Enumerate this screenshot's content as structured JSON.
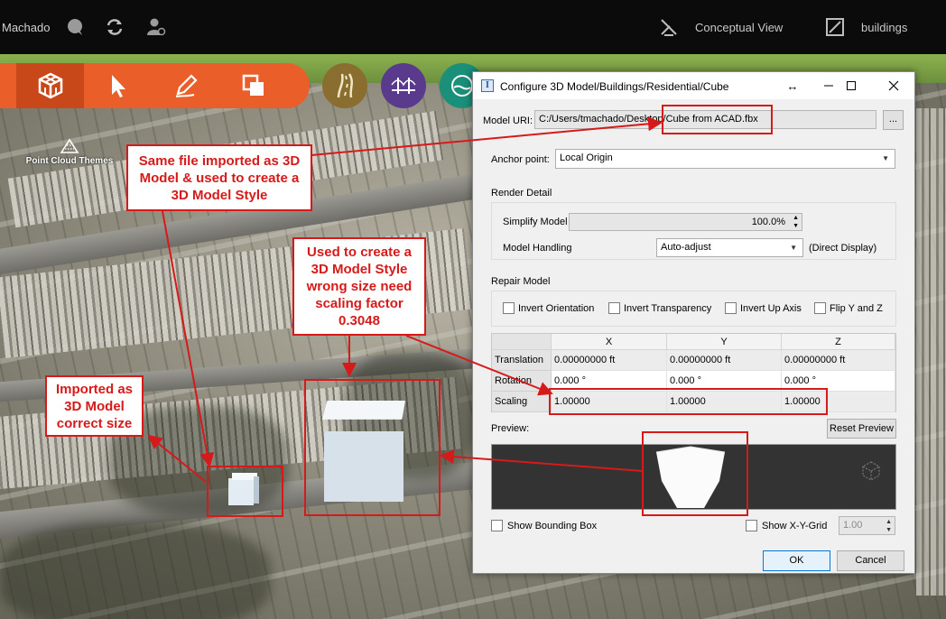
{
  "topbar": {
    "user": "Machado",
    "view_mode": "Conceptual View",
    "layer": "buildings"
  },
  "scene": {
    "point_cloud_label": "Point Cloud Themes"
  },
  "annotations": {
    "callout_same_file": "Same file  imported as 3D Model & used to create a 3D Model Style",
    "callout_style": "Used to create a 3D Model  Style wrong size need scaling factor 0.3048",
    "callout_model": "Imported as 3D Model correct size"
  },
  "dialog": {
    "title": "Configure 3D Model/Buildings/Residential/Cube",
    "model_uri_label": "Model URI:",
    "model_uri_value": "C:/Users/tmachado/Desktop/Cube from ACAD.fbx",
    "browse_label": "...",
    "anchor_label": "Anchor point:",
    "anchor_value": "Local Origin",
    "render_detail_label": "Render Detail",
    "simplify_label": "Simplify Model",
    "simplify_value": "100.0%",
    "handling_label": "Model Handling",
    "handling_value": "Auto-adjust",
    "handling_note": "(Direct Display)",
    "repair_label": "Repair Model",
    "repair_options": [
      "Invert Orientation",
      "Invert Transparency",
      "Invert Up Axis",
      "Flip Y and Z"
    ],
    "grid": {
      "columns": [
        "X",
        "Y",
        "Z"
      ],
      "rows": [
        {
          "label": "Translation",
          "values": [
            "0.00000000 ft",
            "0.00000000 ft",
            "0.00000000 ft"
          ]
        },
        {
          "label": "Rotation",
          "values": [
            "0.000 °",
            "0.000 °",
            "0.000 °"
          ]
        },
        {
          "label": "Scaling",
          "values": [
            "1.00000",
            "1.00000",
            "1.00000"
          ]
        }
      ]
    },
    "preview_label": "Preview:",
    "reset_preview_label": "Reset Preview",
    "show_bbox_label": "Show Bounding Box",
    "show_grid_label": "Show X-Y-Grid",
    "grid_spacing_value": "1.00",
    "ok_label": "OK",
    "cancel_label": "Cancel"
  },
  "colors": {
    "accent_orange": "#ea5e2a",
    "annotation_red": "#d61a1a",
    "road_tool": "#8a6e2f",
    "bridge_tool": "#5a3a8c",
    "water_tool": "#1a8f7a"
  }
}
